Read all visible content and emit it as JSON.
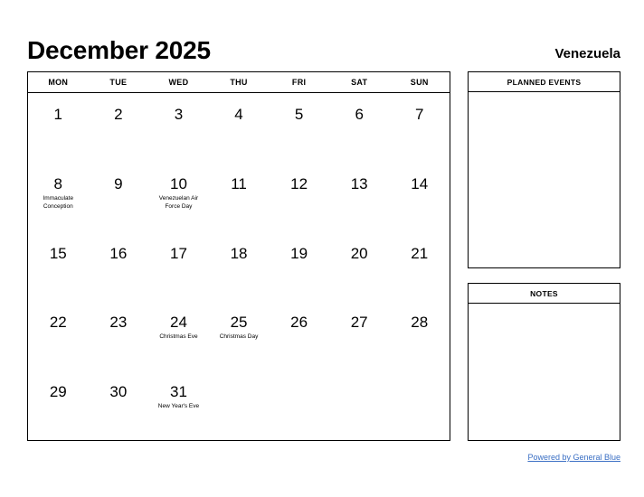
{
  "header": {
    "month_title": "December 2025",
    "country": "Venezuela"
  },
  "calendar": {
    "weekdays": [
      "MON",
      "TUE",
      "WED",
      "THU",
      "FRI",
      "SAT",
      "SUN"
    ],
    "weeks": [
      [
        {
          "day": "1",
          "event": ""
        },
        {
          "day": "2",
          "event": ""
        },
        {
          "day": "3",
          "event": ""
        },
        {
          "day": "4",
          "event": ""
        },
        {
          "day": "5",
          "event": ""
        },
        {
          "day": "6",
          "event": ""
        },
        {
          "day": "7",
          "event": ""
        }
      ],
      [
        {
          "day": "8",
          "event": "Immaculate Conception"
        },
        {
          "day": "9",
          "event": ""
        },
        {
          "day": "10",
          "event": "Venezuelan Air Force Day"
        },
        {
          "day": "11",
          "event": ""
        },
        {
          "day": "12",
          "event": ""
        },
        {
          "day": "13",
          "event": ""
        },
        {
          "day": "14",
          "event": ""
        }
      ],
      [
        {
          "day": "15",
          "event": ""
        },
        {
          "day": "16",
          "event": ""
        },
        {
          "day": "17",
          "event": ""
        },
        {
          "day": "18",
          "event": ""
        },
        {
          "day": "19",
          "event": ""
        },
        {
          "day": "20",
          "event": ""
        },
        {
          "day": "21",
          "event": ""
        }
      ],
      [
        {
          "day": "22",
          "event": ""
        },
        {
          "day": "23",
          "event": ""
        },
        {
          "day": "24",
          "event": "Christmas Eve"
        },
        {
          "day": "25",
          "event": "Christmas Day"
        },
        {
          "day": "26",
          "event": ""
        },
        {
          "day": "27",
          "event": ""
        },
        {
          "day": "28",
          "event": ""
        }
      ],
      [
        {
          "day": "29",
          "event": ""
        },
        {
          "day": "30",
          "event": ""
        },
        {
          "day": "31",
          "event": "New Year's Eve"
        },
        {
          "day": "",
          "event": ""
        },
        {
          "day": "",
          "event": ""
        },
        {
          "day": "",
          "event": ""
        },
        {
          "day": "",
          "event": ""
        }
      ]
    ]
  },
  "panels": {
    "planned_events": {
      "title": "PLANNED EVENTS",
      "content": ""
    },
    "notes": {
      "title": "NOTES",
      "content": ""
    }
  },
  "footer": {
    "powered_by": "Powered by General Blue"
  },
  "colors": {
    "link": "#3a6fc4",
    "border": "#000000",
    "background": "#ffffff",
    "text": "#000000"
  }
}
